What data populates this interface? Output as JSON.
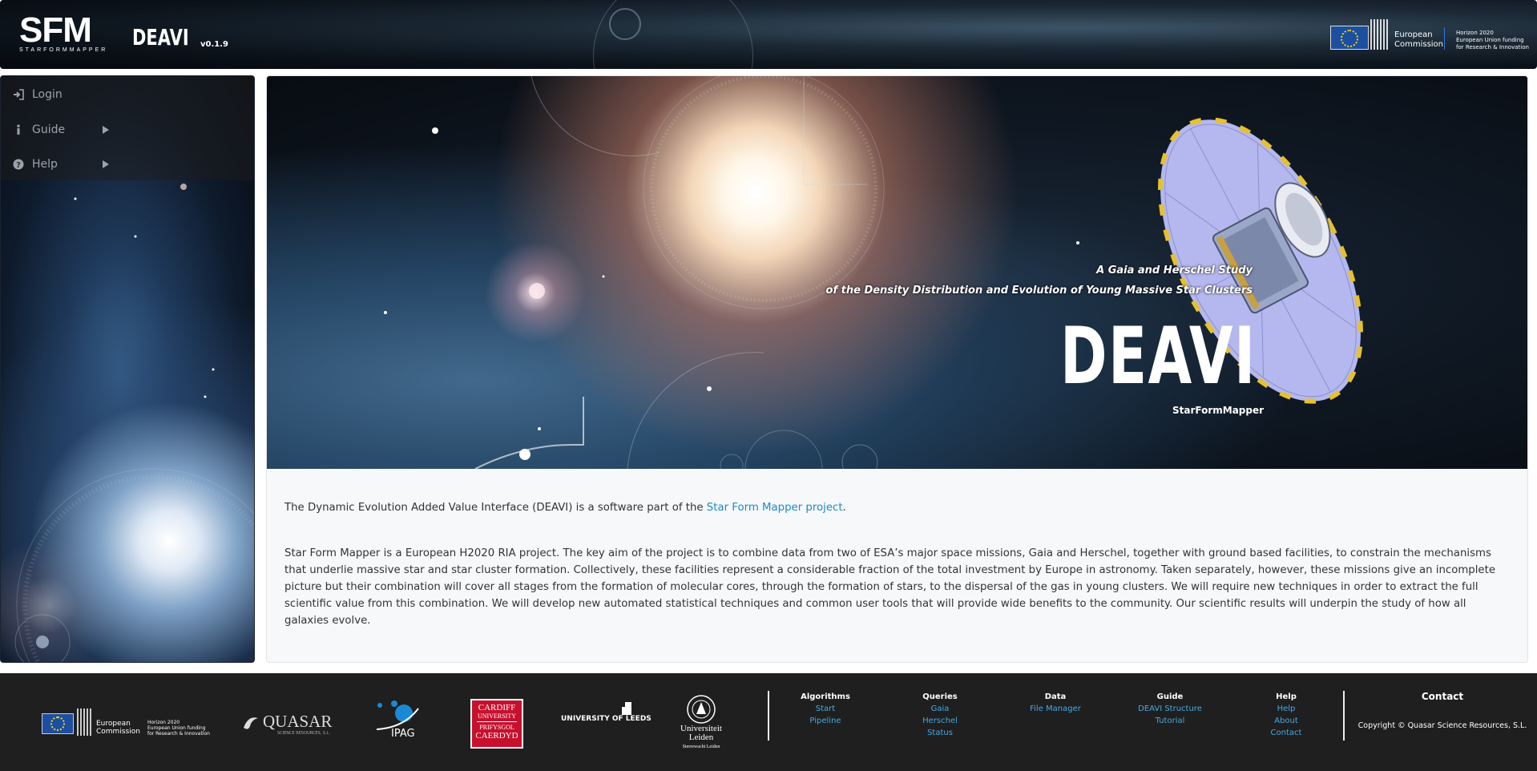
{
  "header": {
    "logo_letters": "SFM",
    "logo_sub": "STARFORMMAPPER",
    "brand": "DEAVI",
    "version": "v0.1.9",
    "ec_text_line1": "European",
    "ec_text_line2": "Commission",
    "h2020_line1": "Horizon 2020",
    "h2020_line2": "European Union funding",
    "h2020_line3": "for Research & Innovation"
  },
  "sidebar": {
    "items": [
      {
        "label": "Login",
        "icon": "sign-in-icon"
      },
      {
        "label": "Guide",
        "icon": "info-icon"
      },
      {
        "label": "Help",
        "icon": "question-circle-icon"
      }
    ]
  },
  "hero": {
    "subtitle1": "A Gaia and Herschel Study",
    "subtitle2": "of the Density Distribution and Evolution of Young Massive Star Clusters",
    "title": "DEAVI",
    "caption": "StarFormMapper"
  },
  "content": {
    "intro_prefix": "The Dynamic Evolution Added Value Interface (DEAVI) is a software part of the ",
    "intro_link": "Star Form Mapper project",
    "intro_suffix": ".",
    "body": "Star Form Mapper is a European H2020 RIA project. The key aim of the project is to combine data from two of ESA’s major space missions, Gaia and Herschel, together with ground based facilities, to constrain the mechanisms that underlie massive star and star cluster formation. Collectively, these facilities represent a considerable fraction of the total investment by Europe in astronomy. Taken separately, however, these missions give an incomplete picture but their combination will cover all stages from the formation of molecular cores, through the formation of stars, to the dispersal of the gas in young clusters. We will require new techniques in order to extract the full scientific value from this combination. We will develop new automated statistical techniques and common user tools that will provide wide benefits to the community. Our scientific results will underpin the study of how all galaxies evolve."
  },
  "footer": {
    "logos": {
      "ec_line1": "European",
      "ec_line2": "Commission",
      "h2020_line1": "Horizon 2020",
      "h2020_line2": "European Union funding",
      "h2020_line3": "for Research & Innovation",
      "quasar": "QUASAR",
      "quasar_sub": "SCIENCE RESOURCES, S.L.",
      "ipag": "IPAG",
      "cardiff_line1": "CARDIFF",
      "cardiff_line2": "UNIVERSITY",
      "cardiff_line3": "PRIFYSGOL",
      "cardiff_line4": "CAERDYD",
      "leeds": "UNIVERSITY OF LEEDS",
      "leiden_line1": "Universiteit",
      "leiden_line2": "Leiden",
      "leiden_line3": "Sterrewacht Leiden"
    },
    "columns": [
      {
        "title": "Algorithms",
        "links": [
          "Start",
          "Pipeline"
        ]
      },
      {
        "title": "Queries",
        "links": [
          "Gaia",
          "Herschel",
          "Status"
        ]
      },
      {
        "title": "Data",
        "links": [
          "File Manager"
        ]
      },
      {
        "title": "Guide",
        "links": [
          "DEAVI Structure",
          "Tutorial"
        ]
      },
      {
        "title": "Help",
        "links": [
          "Help",
          "About",
          "Contact"
        ]
      }
    ],
    "contact_title": "Contact",
    "copyright": "Copyright © Quasar Science Resources, S.L."
  },
  "colors": {
    "link": "#1c8ac9",
    "footer_link": "#48a9e0",
    "footer_bg": "#1f1f1f",
    "cardiff_red": "#c8102e"
  }
}
